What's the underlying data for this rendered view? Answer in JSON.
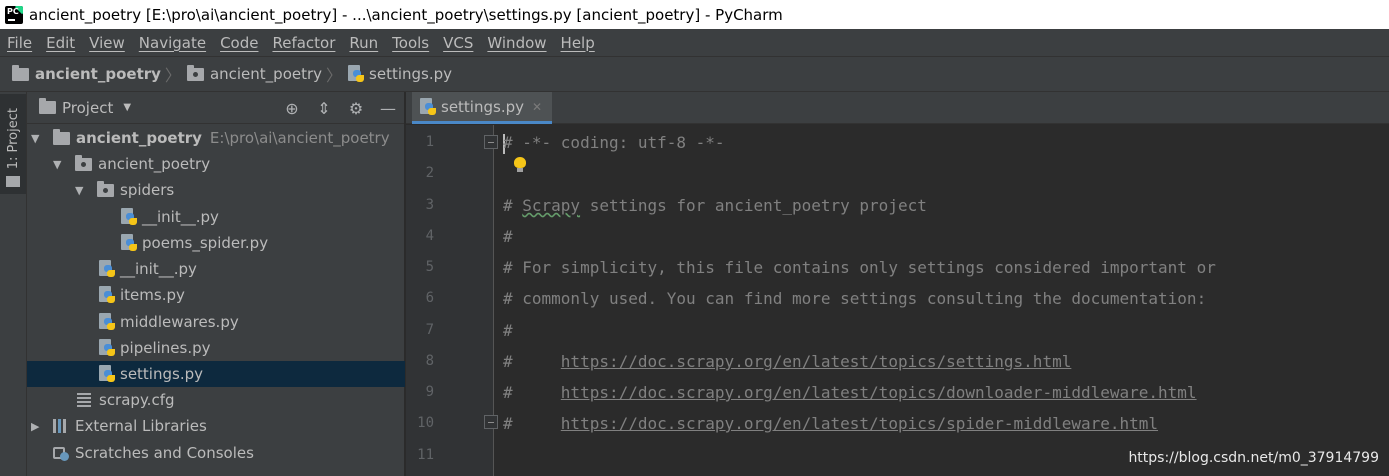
{
  "window": {
    "title": "ancient_poetry [E:\\pro\\ai\\ancient_poetry] - ...\\ancient_poetry\\settings.py [ancient_poetry] - PyCharm"
  },
  "menu": [
    "File",
    "Edit",
    "View",
    "Navigate",
    "Code",
    "Refactor",
    "Run",
    "Tools",
    "VCS",
    "Window",
    "Help"
  ],
  "breadcrumb": [
    "ancient_poetry",
    "ancient_poetry",
    "settings.py"
  ],
  "toolstrip": {
    "project_tab_label": "1: Project"
  },
  "project_panel": {
    "title": "Project",
    "tree": [
      {
        "label": "ancient_poetry",
        "path": "E:\\pro\\ai\\ancient_poetry",
        "type": "folder",
        "expanded": true
      },
      {
        "label": "ancient_poetry",
        "type": "package",
        "expanded": true
      },
      {
        "label": "spiders",
        "type": "package",
        "expanded": true
      },
      {
        "label": "__init__.py",
        "type": "python"
      },
      {
        "label": "poems_spider.py",
        "type": "python"
      },
      {
        "label": "__init__.py",
        "type": "python"
      },
      {
        "label": "items.py",
        "type": "python"
      },
      {
        "label": "middlewares.py",
        "type": "python"
      },
      {
        "label": "pipelines.py",
        "type": "python"
      },
      {
        "label": "settings.py",
        "type": "python",
        "selected": true
      },
      {
        "label": "scrapy.cfg",
        "type": "config"
      },
      {
        "label": "External Libraries",
        "type": "libraries",
        "expanded": false
      },
      {
        "label": "Scratches and Consoles",
        "type": "scratches"
      }
    ]
  },
  "editor": {
    "tab_label": "settings.py",
    "lines": [
      {
        "n": "1",
        "text": "# -*- coding: utf-8 -*-"
      },
      {
        "n": "2",
        "text": ""
      },
      {
        "n": "3",
        "prefix": "# ",
        "typo": "Scrapy",
        "rest": " settings for ancient_poetry project"
      },
      {
        "n": "4",
        "text": "#"
      },
      {
        "n": "5",
        "text": "# For simplicity, this file contains only settings considered important or"
      },
      {
        "n": "6",
        "text": "# commonly used. You can find more settings consulting the documentation:"
      },
      {
        "n": "7",
        "text": "#"
      },
      {
        "n": "8",
        "prefix": "#     ",
        "url": "https://doc.scrapy.org/en/latest/topics/settings.html"
      },
      {
        "n": "9",
        "prefix": "#     ",
        "url": "https://doc.scrapy.org/en/latest/topics/downloader-middleware.html"
      },
      {
        "n": "10",
        "prefix": "#     ",
        "url": "https://doc.scrapy.org/en/latest/topics/spider-middleware.html"
      },
      {
        "n": "11",
        "text": ""
      }
    ]
  },
  "watermark": "https://blog.csdn.net/m0_37914799",
  "colors": {
    "accent": "#4a88c7",
    "selection": "#0d293e",
    "comment": "#808080"
  }
}
